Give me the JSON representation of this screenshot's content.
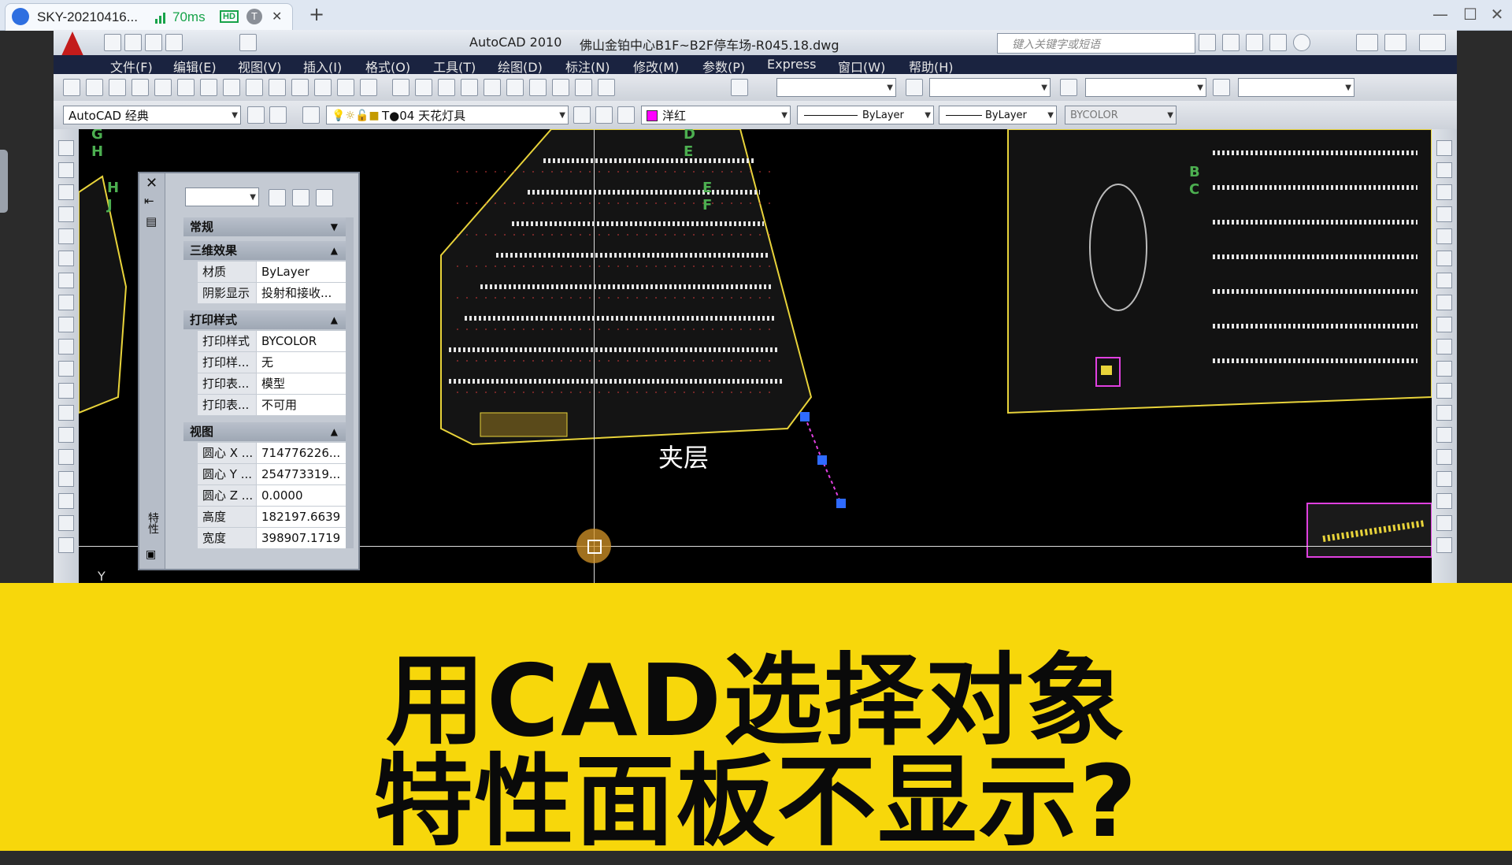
{
  "browser": {
    "tab_title": "SKY-20210416...",
    "ping": "70ms",
    "hd_badge": "HD",
    "t_badge": "T",
    "new_tab": "+",
    "close_tab": "✕",
    "win_min": "—",
    "win_max": "☐",
    "win_close": "✕"
  },
  "cad": {
    "app_name": "AutoCAD 2010",
    "file_name": "佛山金铂中心B1F~B2F停车场-R045.18.dwg",
    "search_placeholder": "键入关键字或短语",
    "menu": [
      "文件(F)",
      "编辑(E)",
      "视图(V)",
      "插入(I)",
      "格式(O)",
      "工具(T)",
      "绘图(D)",
      "标注(N)",
      "修改(M)",
      "参数(P)",
      "Express",
      "窗口(W)",
      "帮助(H)"
    ],
    "workspace": "AutoCAD 经典",
    "layer": "T●04 天花灯具",
    "color": "洋红",
    "linetype": "ByLayer",
    "lineweight": "ByLayer",
    "plotstyle": "BYCOLOR"
  },
  "drawing": {
    "label_mezzanine": "夹层",
    "grid_labels": [
      "G",
      "H",
      "H",
      "J",
      "D",
      "E",
      "E",
      "F",
      "B",
      "C"
    ],
    "ucs_y": "Y",
    "colors": {
      "parking_line": "#e6e6e6",
      "yellow": "#e8d33a",
      "red": "#d23a3a",
      "grip": "#2f6bff",
      "magenta": "#e040e0",
      "green": "#4caf50"
    }
  },
  "properties": {
    "selector_value": "",
    "side_label": "特性",
    "sections": [
      {
        "title": "常规",
        "collapsed": true,
        "rows": []
      },
      {
        "title": "三维效果",
        "collapsed": false,
        "rows": [
          {
            "k": "材质",
            "v": "ByLayer"
          },
          {
            "k": "阴影显示",
            "v": "投射和接收..."
          }
        ]
      },
      {
        "title": "打印样式",
        "collapsed": false,
        "rows": [
          {
            "k": "打印样式",
            "v": "BYCOLOR"
          },
          {
            "k": "打印样...",
            "v": "无"
          },
          {
            "k": "打印表...",
            "v": "模型"
          },
          {
            "k": "打印表...",
            "v": "不可用"
          }
        ]
      },
      {
        "title": "视图",
        "collapsed": false,
        "rows": [
          {
            "k": "圆心 X ...",
            "v": "714776226..."
          },
          {
            "k": "圆心 Y ...",
            "v": "254773319..."
          },
          {
            "k": "圆心 Z ...",
            "v": "0.0000"
          },
          {
            "k": "高度",
            "v": "182197.6639"
          },
          {
            "k": "宽度",
            "v": "398907.1719"
          }
        ]
      }
    ]
  },
  "banner": {
    "line1": "用CAD选择对象",
    "line2": "特性面板不显示?"
  }
}
